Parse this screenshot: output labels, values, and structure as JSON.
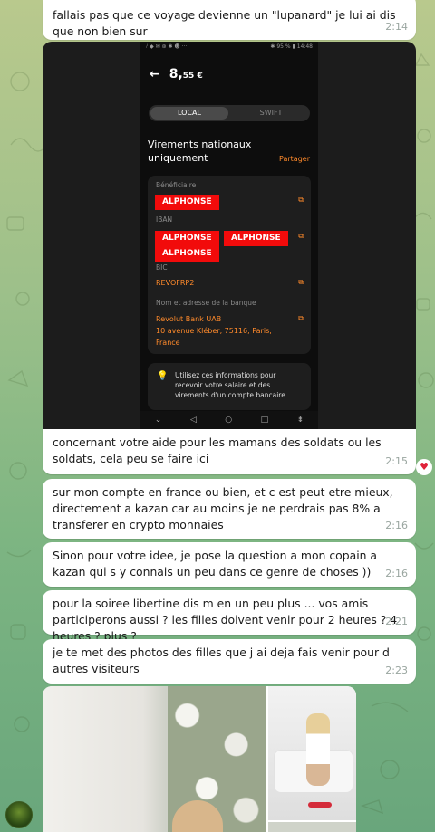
{
  "messages": [
    {
      "text": "fallais pas que ce voyage devienne un \"lupanard\" je lui ai dis que non bien sur",
      "time": "2:14"
    },
    {
      "text": "concernant votre aide pour les mamans des soldats ou les soldats, cela peu se faire ici",
      "time": "2:15",
      "reaction": "♥"
    },
    {
      "text": "sur mon compte en france ou bien, et c est peut etre mieux, directement a kazan car au moins je ne perdrais pas 8% a transferer en crypto monnaies",
      "time": "2:16"
    },
    {
      "text": "Sinon pour votre idee, je pose la question a mon copain a kazan qui s y connais un peu dans ce genre de choses ))",
      "time": "2:16"
    },
    {
      "text": "pour la soiree libertine dis m en un peu plus ... vos amis participerons aussi ? les filles doivent venir pour 2 heures ? 4 heures ? plus ?",
      "time": "2:21"
    },
    {
      "text": "je te met des photos des filles que j ai deja fais venir pour d autres visiteurs",
      "time": "2:23"
    }
  ],
  "screenshot": {
    "status_left": "ᵢᴵ ◆ ✉ ⊛ ✱ ☻ ···",
    "status_right": "✱ 95 % ▮ 14:48",
    "back_arrow": "←",
    "amount_main": "8,",
    "amount_cents": "55 €",
    "tab_local": "LOCAL",
    "tab_swift": "SWIFT",
    "section_title": "Virements nationaux uniquement",
    "share": "Partager",
    "label_beneficiary": "Bénéficiaire",
    "redaction_1": "ALPHONSE",
    "label_iban": "IBAN",
    "redaction_2": "ALPHONSE",
    "redaction_3": "ALPHONSE",
    "redaction_4": "ALPHONSE",
    "label_bic": "BIC",
    "bic_value": "REVOFRP2",
    "label_bank": "Nom et adresse de la banque",
    "bank_line1": "Revolut Bank UAB",
    "bank_line2": "10 avenue Kléber, 75116, Paris,",
    "bank_line3": "France",
    "info_text": "Utilisez ces informations pour recevoir votre salaire et des virements d'un compte bancaire",
    "copy_icon": "⧉",
    "bulb_icon": "💡",
    "nav_down": "⌄",
    "nav_back": "◁",
    "nav_home": "○",
    "nav_recent": "□",
    "nav_kbd": "⇟"
  },
  "colors": {
    "redaction": "#f20b0b",
    "accent": "#ff8a2b",
    "bubble": "#ffffff",
    "time": "#9aa6a0"
  }
}
